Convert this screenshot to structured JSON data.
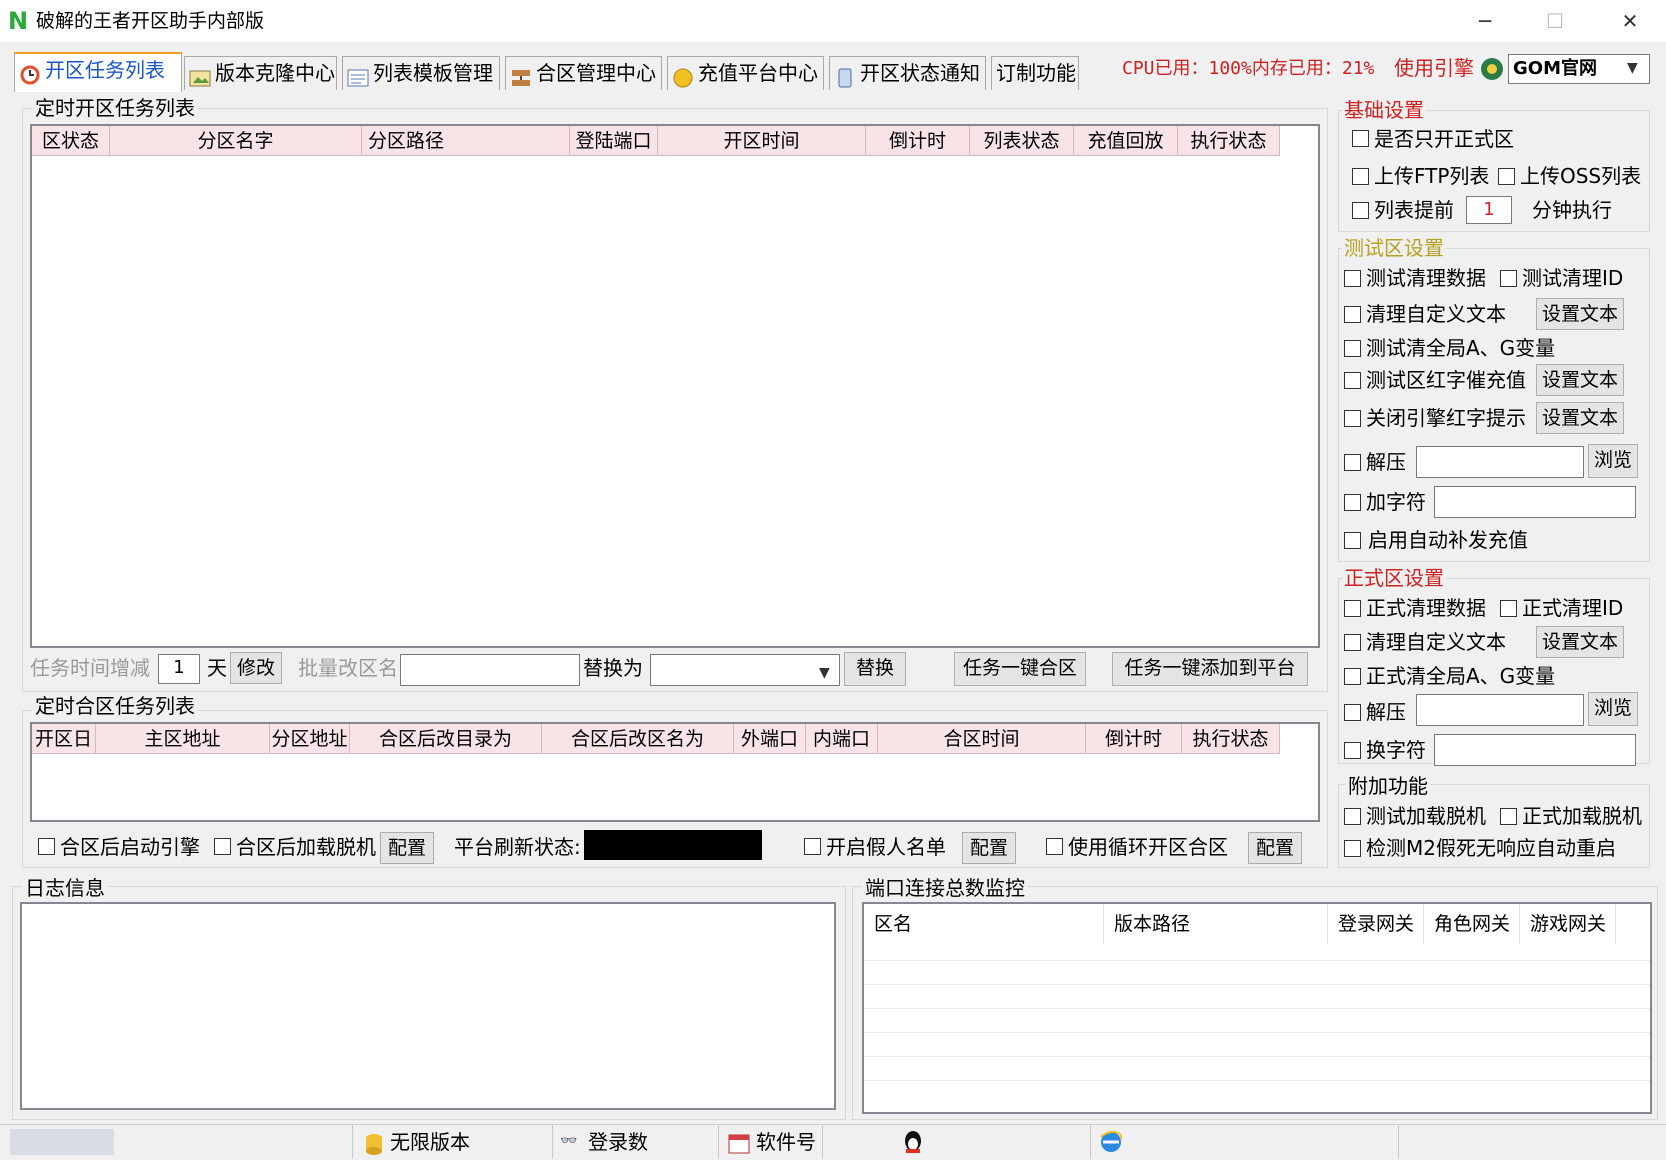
{
  "window": {
    "title": "破解的王者开区助手内部版",
    "min": "─",
    "max": "☐",
    "close": "✕"
  },
  "tabs": [
    {
      "label": "开区任务列表"
    },
    {
      "label": "版本克隆中心"
    },
    {
      "label": "列表模板管理"
    },
    {
      "label": "合区管理中心"
    },
    {
      "label": "充值平台中心"
    },
    {
      "label": "开区状态通知"
    },
    {
      "label": "订制功能"
    }
  ],
  "sysinfo": {
    "text": "CPU已用：100%内存已用：21%",
    "engine_label": "使用引擎",
    "engine_value": "GOM官网"
  },
  "open_tasks": {
    "title": "定时开区任务列表",
    "columns": [
      "区状态",
      "分区名字",
      "分区路径",
      "登陆端口",
      "开区时间",
      "倒计时",
      "列表状态",
      "充值回放",
      "执行状态"
    ],
    "time_adjust_label": "任务时间增减",
    "time_adjust_value": "1",
    "day_label": "天",
    "modify_btn": "修改",
    "batch_rename_label": "批量改区名",
    "replace_with_label": "替换为",
    "replace_btn": "替换",
    "merge_all_btn": "任务一键合区",
    "add_platform_btn": "任务一键添加到平台"
  },
  "merge_tasks": {
    "title": "定时合区任务列表",
    "columns": [
      "开区日",
      "主区地址",
      "分区地址",
      "合区后改目录为",
      "合区后改区名为",
      "外端口",
      "内端口",
      "合区时间",
      "倒计时",
      "执行状态"
    ],
    "start_engine_after": "合区后启动引擎",
    "load_offline_after": "合区后加载脱机",
    "config_btn": "配置",
    "platform_refresh_label": "平台刷新状态:",
    "fake_list": "开启假人名单",
    "config_btn2": "配置",
    "loop_merge": "使用循环开区合区",
    "config_btn3": "配置"
  },
  "basic": {
    "title": "基础设置",
    "only_official": "是否只开正式区",
    "upload_ftp": "上传FTP列表",
    "upload_oss": "上传OSS列表",
    "list_advance": "列表提前",
    "advance_minutes": "1",
    "minutes_exec": "分钟执行"
  },
  "test": {
    "title": "测试区设置",
    "clear_data": "测试清理数据",
    "clear_id": "测试清理ID",
    "clear_custom": "清理自定义文本",
    "set_text": "设置文本",
    "clear_global": "测试清全局A、G变量",
    "red_recharge": "测试区红字催充值",
    "set_text2": "设置文本",
    "close_red": "关闭引擎红字提示",
    "set_text3": "设置文本",
    "unzip": "解压",
    "browse": "浏览",
    "add_char": "加字符",
    "auto_recharge": "启用自动补发充值"
  },
  "official": {
    "title": "正式区设置",
    "clear_data": "正式清理数据",
    "clear_id": "正式清理ID",
    "clear_custom": "清理自定义文本",
    "set_text": "设置文本",
    "clear_global": "正式清全局A、G变量",
    "unzip": "解压",
    "browse": "浏览",
    "replace_char": "换字符"
  },
  "extra": {
    "title": "附加功能",
    "test_offline": "测试加载脱机",
    "official_offline": "正式加载脱机",
    "detect_m2": "检测M2假死无响应自动重启"
  },
  "log": {
    "title": "日志信息"
  },
  "port_monitor": {
    "title": "端口连接总数监控",
    "columns": [
      "区名",
      "版本路径",
      "登录网关",
      "角色网关",
      "游戏网关"
    ]
  },
  "statusbar": {
    "unlimited": "无限版本",
    "logins": "登录数",
    "software_no": "软件号"
  },
  "colors": {
    "tab_active_text": "#1a56c9",
    "header_pink": "#f8e4e6",
    "section_red": "#cc2222",
    "section_olive": "#b8a020"
  }
}
